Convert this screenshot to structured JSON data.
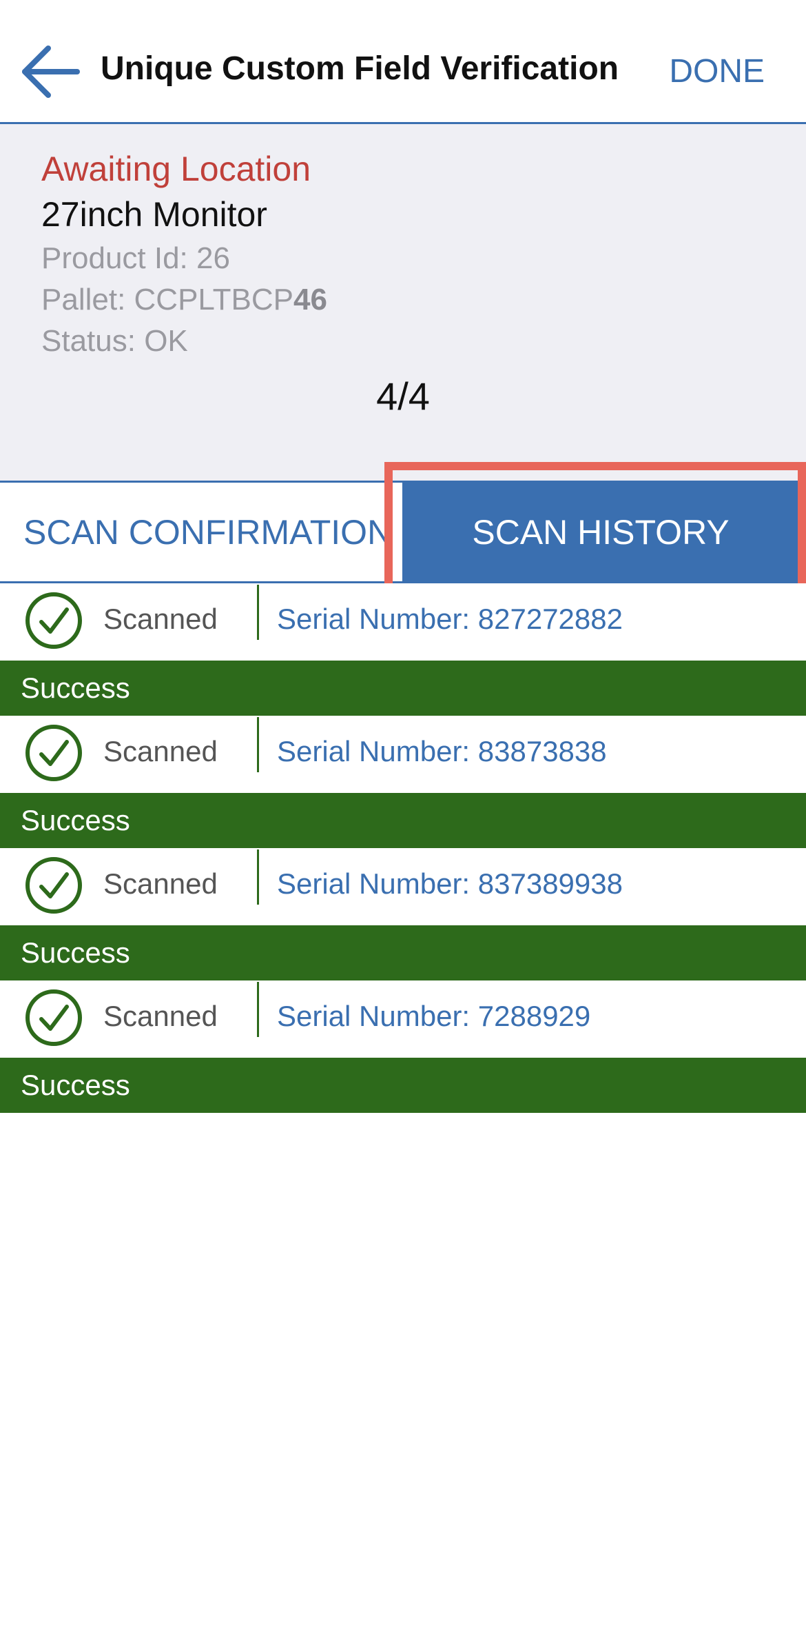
{
  "header": {
    "title": "Unique Custom Field Verification",
    "done_label": "DONE",
    "accent_color": "#3a6fb0"
  },
  "info": {
    "status_title": "Awaiting Location",
    "product_name": "27inch Monitor",
    "product_id": "Product Id: 26",
    "pallet_prefix": "Pallet: CCPLTBCP",
    "pallet_suffix": "46",
    "status": "Status: OK",
    "counter": "4/4"
  },
  "tabs": [
    {
      "label": "SCAN CONFIRMATION",
      "active": false
    },
    {
      "label": "SCAN HISTORY",
      "active": true
    }
  ],
  "scans": [
    {
      "state": "Scanned",
      "serial": "Serial Number: 827272882",
      "result": "Success"
    },
    {
      "state": "Scanned",
      "serial": "Serial Number: 83873838",
      "result": "Success"
    },
    {
      "state": "Scanned",
      "serial": "Serial Number: 837389938",
      "result": "Success"
    },
    {
      "state": "Scanned",
      "serial": "Serial Number: 7288929",
      "result": "Success"
    }
  ],
  "colors": {
    "success": "#2d6a1b",
    "warning": "#c0403a",
    "highlight": "#e8665a"
  },
  "icons": {
    "back": "arrow-left-icon",
    "scanned": "check-circle-icon"
  }
}
